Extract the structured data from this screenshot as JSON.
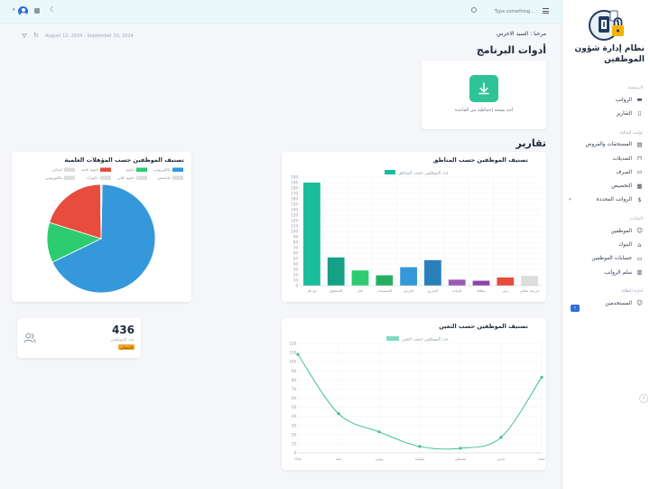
{
  "header": {
    "search_placeholder": "Type something...",
    "date_range": "August 12, 2024 - September 10, 2024",
    "welcome": "مرحبا : السيد الاخرس"
  },
  "sidebar": {
    "app_title": "نظام إدارة شؤون الموظفين",
    "sections": [
      {
        "label": "الرئيسية",
        "items": [
          {
            "label": "الرواتب",
            "icon": "folder-icon"
          },
          {
            "label": "التقارير",
            "icon": "document-icon"
          }
        ]
      },
      {
        "label": "ثوابت المالية",
        "items": [
          {
            "label": "المستحقات والقروض",
            "icon": "ledger-icon"
          },
          {
            "label": "التعديلات",
            "icon": "lock-icon"
          },
          {
            "label": "الصرف",
            "icon": "cart-icon"
          },
          {
            "label": "التخصيص",
            "icon": "calculator-icon"
          },
          {
            "label": "الرواتب المحددة",
            "icon": "dollar-icon"
          }
        ]
      },
      {
        "label": "البيانات",
        "items": [
          {
            "label": "الموظفين",
            "icon": "users-icon"
          },
          {
            "label": "البنوك",
            "icon": "bank-icon"
          },
          {
            "label": "حسابات الموظفين",
            "icon": "card-icon"
          },
          {
            "label": "سلم الرواتب",
            "icon": "chart-icon"
          }
        ]
      },
      {
        "label": "ادارة النظام",
        "items": [
          {
            "label": "المستخدمين",
            "icon": "user-icon"
          }
        ]
      }
    ]
  },
  "tools": {
    "heading": "أدوات البرنامج",
    "backup_label": "أخذ نسخة إحتياطية من القاعدة"
  },
  "reports_heading": "تقارير",
  "stat": {
    "value": "436",
    "label": "عدد الموظفين",
    "badge": "الاجمالي"
  },
  "colors": {
    "teal": "#1abc9c",
    "blue": "#3498db",
    "green": "#2ecc71",
    "red": "#e74c3c",
    "brand": "#1f3a5f"
  },
  "chart_data": [
    {
      "type": "bar",
      "title": "تصنيف الموظفين حسب المناطق",
      "legend": [
        "عدد الموظفين حسب المناطق"
      ],
      "categories": [
        "ذي قار",
        "السماوي",
        "بابل",
        "الحسينيات",
        "ناجرنين",
        "المزرع",
        "الزيادة",
        "نطاط",
        "زبير",
        "مزرعة صافي"
      ],
      "values": [
        190,
        52,
        28,
        19,
        34,
        47,
        11,
        9,
        15,
        18
      ],
      "ylim": [
        0,
        200
      ],
      "yticks": [
        "0",
        "10",
        "20",
        "30",
        "40",
        "50",
        "60",
        "70",
        "80",
        "90",
        "100",
        "110",
        "120",
        "130",
        "140",
        "150",
        "160",
        "170",
        "180",
        "190",
        "200"
      ],
      "bar_colors": [
        "#1abc9c",
        "#16a085",
        "#2ecc71",
        "#27ae60",
        "#3498db",
        "#2980b9",
        "#9b59b6",
        "#8e44ad",
        "#e74c3c",
        "#dddddd"
      ]
    },
    {
      "type": "pie",
      "title": "تصنيف الموظفين حسب المؤهلات العلمية",
      "legend": [
        {
          "label": "بكالوريوس",
          "color": "#3498db"
        },
        {
          "label": "دبلوم",
          "color": "#2ecc71"
        },
        {
          "label": "ثانوية عامة",
          "color": "#e74c3c"
        },
        {
          "label": "ابتدائي",
          "color": "#dddddd"
        },
        {
          "label": "ماجستير",
          "color": "#dddddd"
        },
        {
          "label": "دبلوم عالي",
          "color": "#dddddd"
        },
        {
          "label": "دكتوراه",
          "color": "#dddddd"
        },
        {
          "label": "بكالوريوس",
          "color": "#dddddd"
        }
      ],
      "values": [
        67.5,
        12,
        20,
        0.5
      ],
      "slice_colors": [
        "#3498db",
        "#2ecc71",
        "#e74c3c",
        "#dddddd"
      ]
    },
    {
      "type": "line",
      "title": "تصنيف الموظفين حسب التعين",
      "legend": [
        "عدد الموظفين حسب التعين"
      ],
      "categories": [
        "ملاك",
        "عقد",
        "يومي",
        "مياومة",
        "تشغيلي",
        "جزئي",
        "منحة"
      ],
      "values": [
        108,
        43,
        23,
        7,
        5,
        17,
        83
      ],
      "ylim": [
        0,
        120
      ],
      "yticks": [
        "0",
        "10",
        "20",
        "30",
        "40",
        "50",
        "60",
        "70",
        "80",
        "90",
        "100",
        "110",
        "120"
      ]
    }
  ]
}
